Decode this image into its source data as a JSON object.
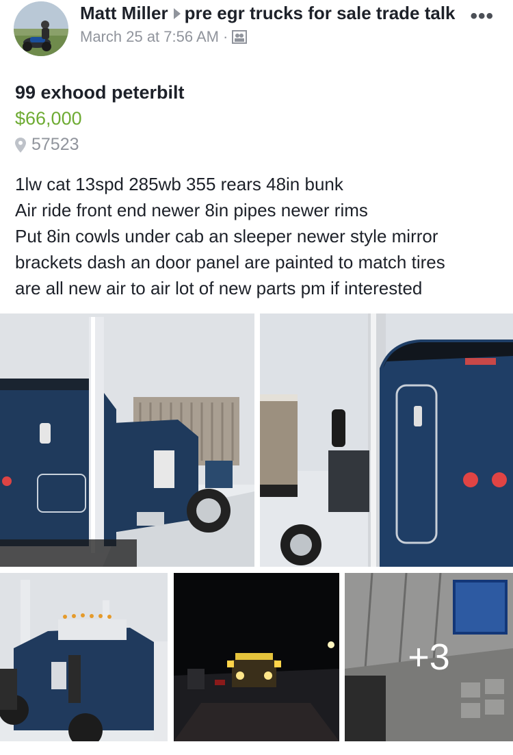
{
  "post": {
    "author": "Matt Miller",
    "group": "pre egr trucks for sale trade talk",
    "timestamp": "March 25 at 7:56 AM",
    "separator": "·",
    "privacy_icon": "group-icon",
    "more_icon": "more-options-icon",
    "more_label": "•••"
  },
  "listing": {
    "title": "99 exhood peterbilt",
    "price": "$66,000",
    "location": "57523",
    "location_icon": "location-pin-icon",
    "description_lines": [
      "1lw cat 13spd 285wb 355 rears 48in bunk",
      "Air ride front end newer 8in pipes newer rims",
      "Put 8in cowls under cab an sleeper newer style mirror",
      "brackets dash an door panel are painted to match tires",
      "are all new air to air lot of new parts pm if interested"
    ]
  },
  "photos": {
    "more_count": "+3"
  },
  "colors": {
    "price": "#6eab33",
    "muted": "#90949c",
    "text": "#1d2129"
  }
}
